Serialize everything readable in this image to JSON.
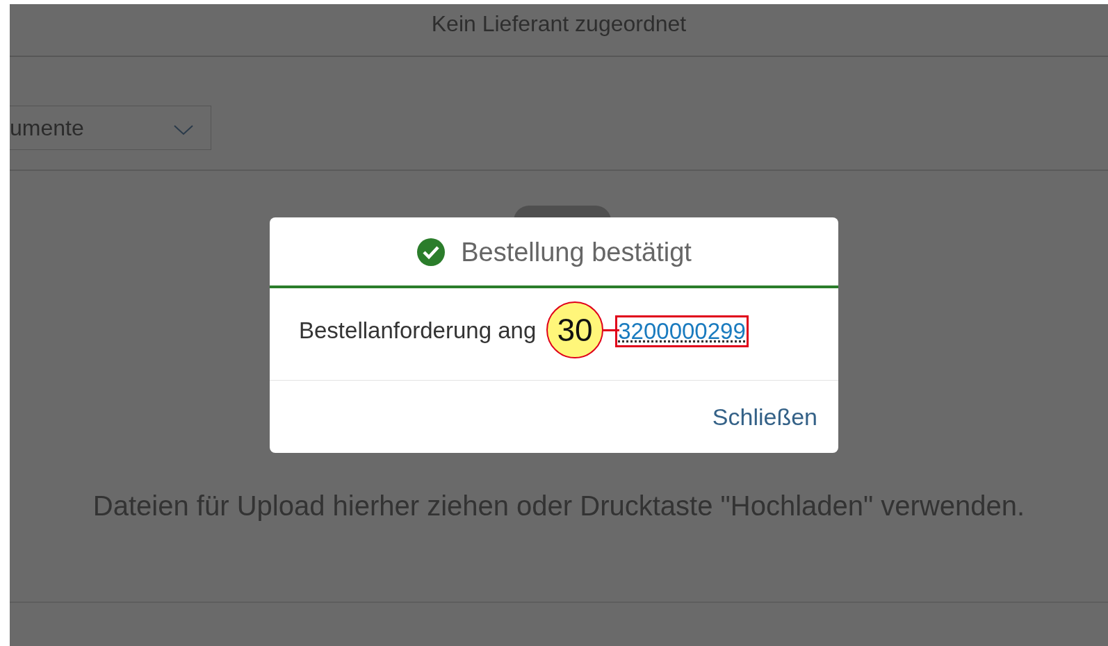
{
  "background": {
    "header_title": "Kein Lieferant zugeordnet",
    "dropdown": {
      "value": "umente"
    },
    "upload_hint": "Dateien für Upload hierher ziehen oder Drucktaste \"Hochladen\" verwenden."
  },
  "dialog": {
    "title": "Bestellung bestätigt",
    "success": true,
    "message": "Bestellanforderung ang",
    "link": "3200000299",
    "buttons": [
      "Schließen"
    ]
  },
  "callout": {
    "number": "30"
  }
}
